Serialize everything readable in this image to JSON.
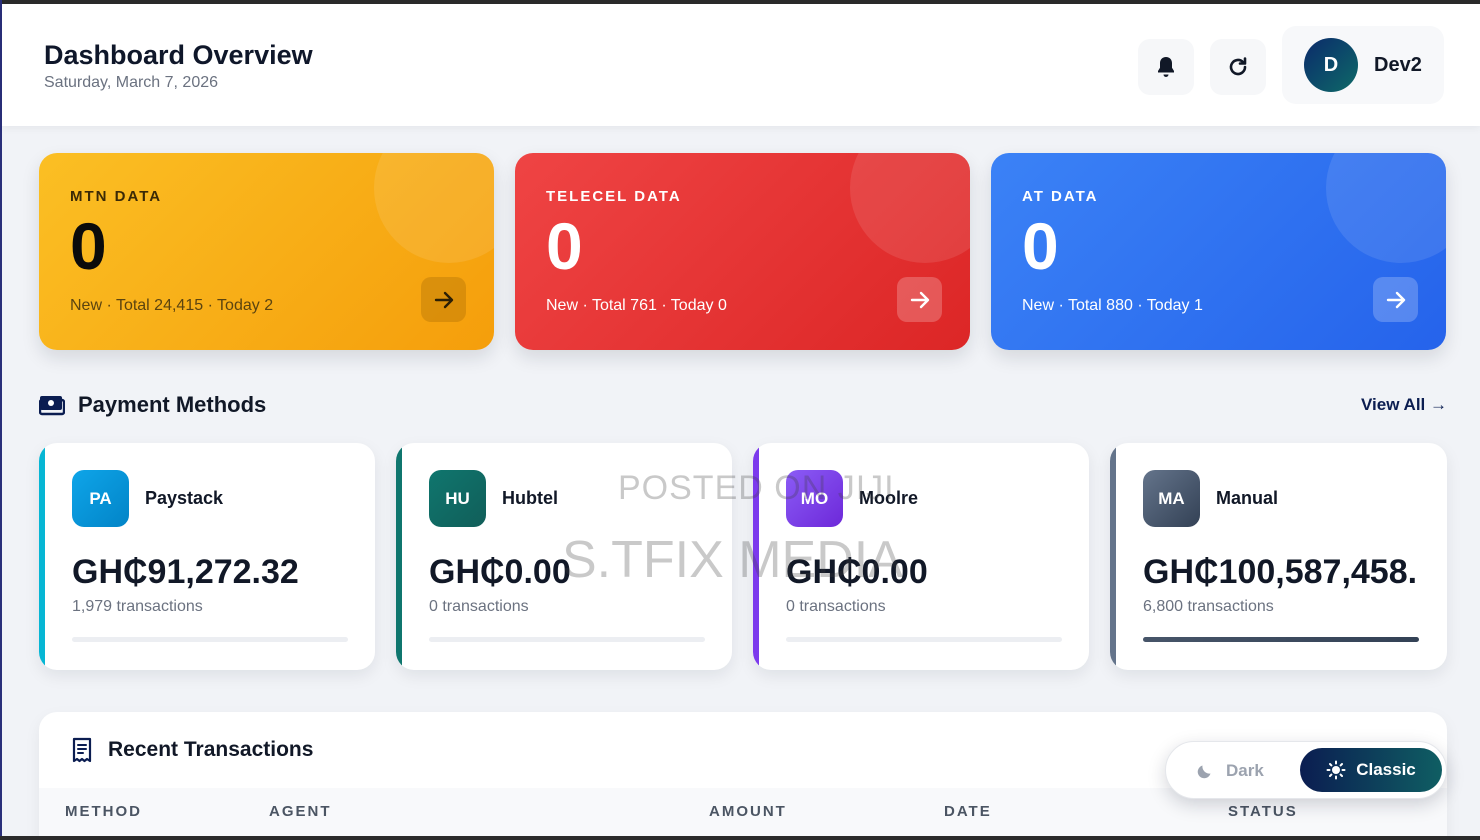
{
  "header": {
    "title": "Dashboard Overview",
    "date": "Saturday, March 7, 2026",
    "user": {
      "initial": "D",
      "name": "Dev2"
    }
  },
  "network_cards": [
    {
      "title": "MTN DATA",
      "value": "0",
      "subtitle": "New · Total 24,415 · Today 2",
      "color": "#f59e0b"
    },
    {
      "title": "TELECEL DATA",
      "value": "0",
      "subtitle": "New · Total 761 · Today 0",
      "color": "#dc2626"
    },
    {
      "title": "AT DATA",
      "value": "0",
      "subtitle": "New · Total 880 · Today 1",
      "color": "#2563eb"
    }
  ],
  "payment_methods": {
    "title": "Payment Methods",
    "view_all": "View All →",
    "items": [
      {
        "abbr": "PA",
        "name": "Paystack",
        "amount": "GH₵91,272.32",
        "transactions": "1,979 transactions",
        "accent": "#06b6d4",
        "share": 0
      },
      {
        "abbr": "HU",
        "name": "Hubtel",
        "amount": "GH₵0.00",
        "transactions": "0 transactions",
        "accent": "#0f766e",
        "share": 0
      },
      {
        "abbr": "MO",
        "name": "Moolre",
        "amount": "GH₵0.00",
        "transactions": "0 transactions",
        "accent": "#7c3aed",
        "share": 0
      },
      {
        "abbr": "MA",
        "name": "Manual",
        "amount": "GH₵100,587,458.",
        "transactions": "6,800 transactions",
        "accent": "#475569",
        "share": 1
      }
    ]
  },
  "watermark": {
    "line1": "POSTED ON JIJI",
    "line2": "S.TFIX MEDIA"
  },
  "recent_transactions": {
    "title": "Recent Transactions",
    "columns": [
      "METHOD",
      "AGENT",
      "AMOUNT",
      "DATE",
      "STATUS"
    ]
  },
  "theme_toggle": {
    "dark_label": "Dark",
    "classic_label": "Classic",
    "selected": "Classic"
  }
}
